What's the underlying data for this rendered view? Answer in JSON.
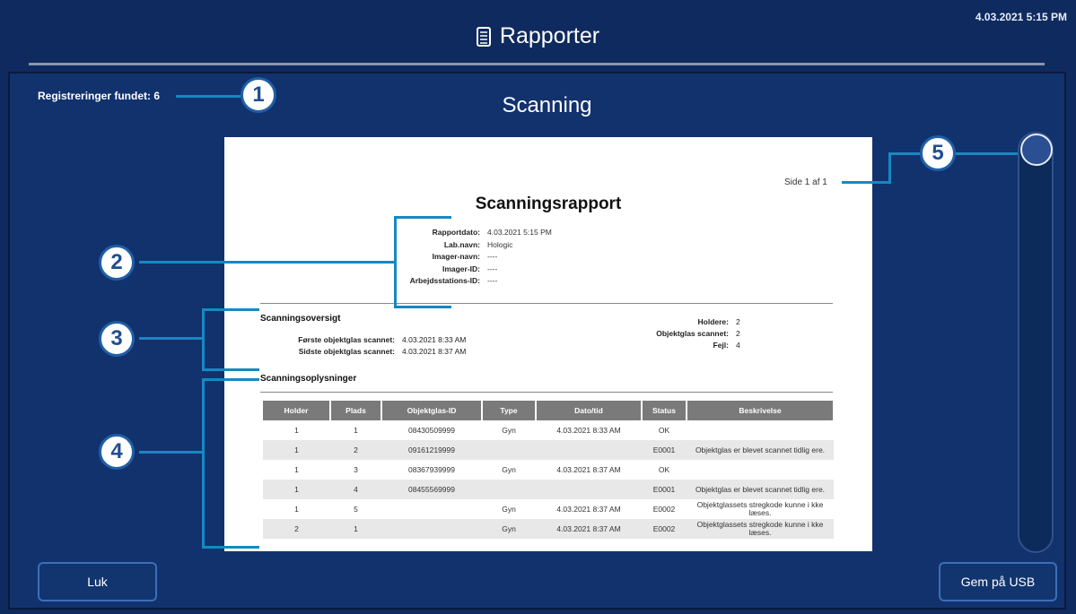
{
  "header": {
    "title": "Rapporter",
    "timestamp": "4.03.2021 5:15 PM",
    "icon": "document-icon"
  },
  "main": {
    "records_found": "Registreringer fundet: 6",
    "title": "Scanning"
  },
  "report": {
    "page_label": "Side 1 af 1",
    "title": "Scanningsrapport",
    "meta": [
      {
        "key": "Rapportdato:",
        "value": "4.03.2021 5:15 PM"
      },
      {
        "key": "Lab.navn:",
        "value": "Hologic"
      },
      {
        "key": "Imager-navn:",
        "value": "----"
      },
      {
        "key": "Imager-ID:",
        "value": "----"
      },
      {
        "key": "Arbejdsstations-ID:",
        "value": "----"
      }
    ],
    "overview": {
      "heading": "Scanningsoversigt",
      "left": [
        {
          "key": "Første objektglas scannet:",
          "value": "4.03.2021 8:33 AM"
        },
        {
          "key": "Sidste objektglas scannet:",
          "value": "4.03.2021 8:37 AM"
        }
      ],
      "right": [
        {
          "key": "Holdere:",
          "value": "2"
        },
        {
          "key": "Objektglas scannet:",
          "value": "2"
        },
        {
          "key": "Fejl:",
          "value": "4"
        }
      ]
    },
    "details": {
      "heading": "Scanningsoplysninger",
      "columns": [
        "Holder",
        "Plads",
        "Objektglas-ID",
        "Type",
        "Dato/tid",
        "Status",
        "Beskrivelse"
      ],
      "rows": [
        [
          "1",
          "1",
          "08430509999",
          "Gyn",
          "4.03.2021 8:33 AM",
          "OK",
          ""
        ],
        [
          "1",
          "2",
          "09161219999",
          "",
          "",
          "E0001",
          "Objektglas er blevet scannet tidlig ere."
        ],
        [
          "1",
          "3",
          "08367939999",
          "Gyn",
          "4.03.2021 8:37 AM",
          "OK",
          ""
        ],
        [
          "1",
          "4",
          "08455569999",
          "",
          "",
          "E0001",
          "Objektglas er blevet scannet tidlig ere."
        ],
        [
          "1",
          "5",
          "",
          "Gyn",
          "4.03.2021 8:37 AM",
          "E0002",
          "Objektglassets stregkode kunne i kke læses."
        ],
        [
          "2",
          "1",
          "",
          "Gyn",
          "4.03.2021 8:37 AM",
          "E0002",
          "Objektglassets stregkode kunne i kke læses."
        ]
      ]
    }
  },
  "callouts": [
    "1",
    "2",
    "3",
    "4",
    "5"
  ],
  "buttons": {
    "close": "Luk",
    "save_usb": "Gem på USB"
  },
  "colors": {
    "background": "#11326d",
    "header": "#0f2a5e",
    "callout_border": "#1f5fa8",
    "callout_line": "#1788c2",
    "table_header": "#7a7a7a"
  }
}
